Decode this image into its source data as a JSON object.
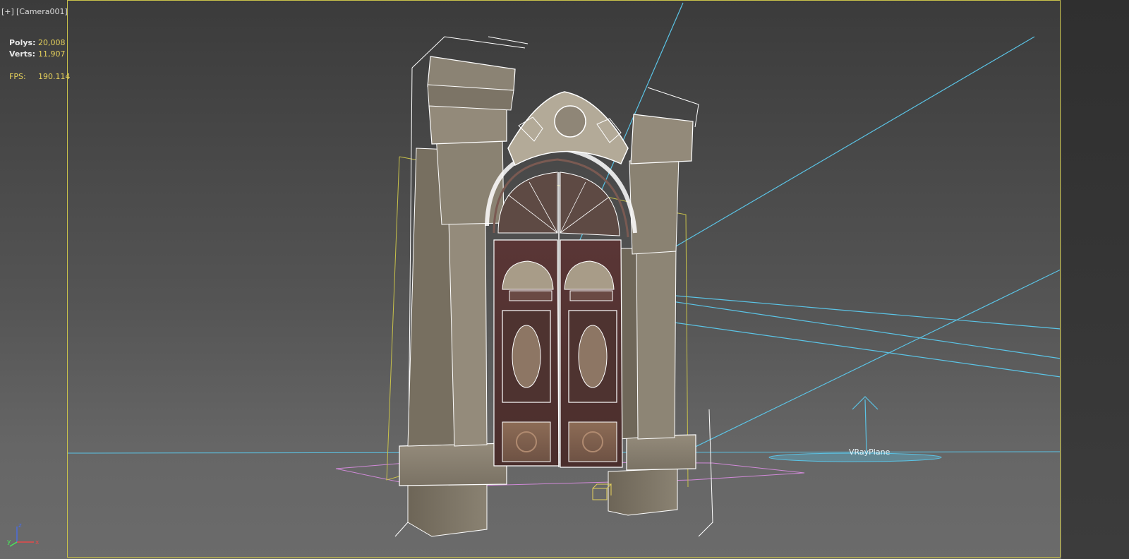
{
  "viewport": {
    "menu_label": "[+]",
    "camera_label": "[Camera001]"
  },
  "stats": {
    "polys_label": "Polys:",
    "polys_value": "20,008",
    "verts_label": "Verts:",
    "verts_value": "11,907",
    "fps_label": "FPS:",
    "fps_value": "190.114"
  },
  "scene": {
    "vray_plane_label": "VRayPlane",
    "object_icons": [
      "door-portal-model",
      "vray-light-plane",
      "camera-target-icon"
    ]
  },
  "axis": {
    "x": "x",
    "y": "y",
    "z": "z"
  },
  "colors": {
    "safe_frame": "#c9c24a",
    "stats_value": "#e6d15c",
    "light_lines": "#5bc4e6",
    "wire": "#ffffff",
    "ground_plane": "#d08ad8"
  }
}
